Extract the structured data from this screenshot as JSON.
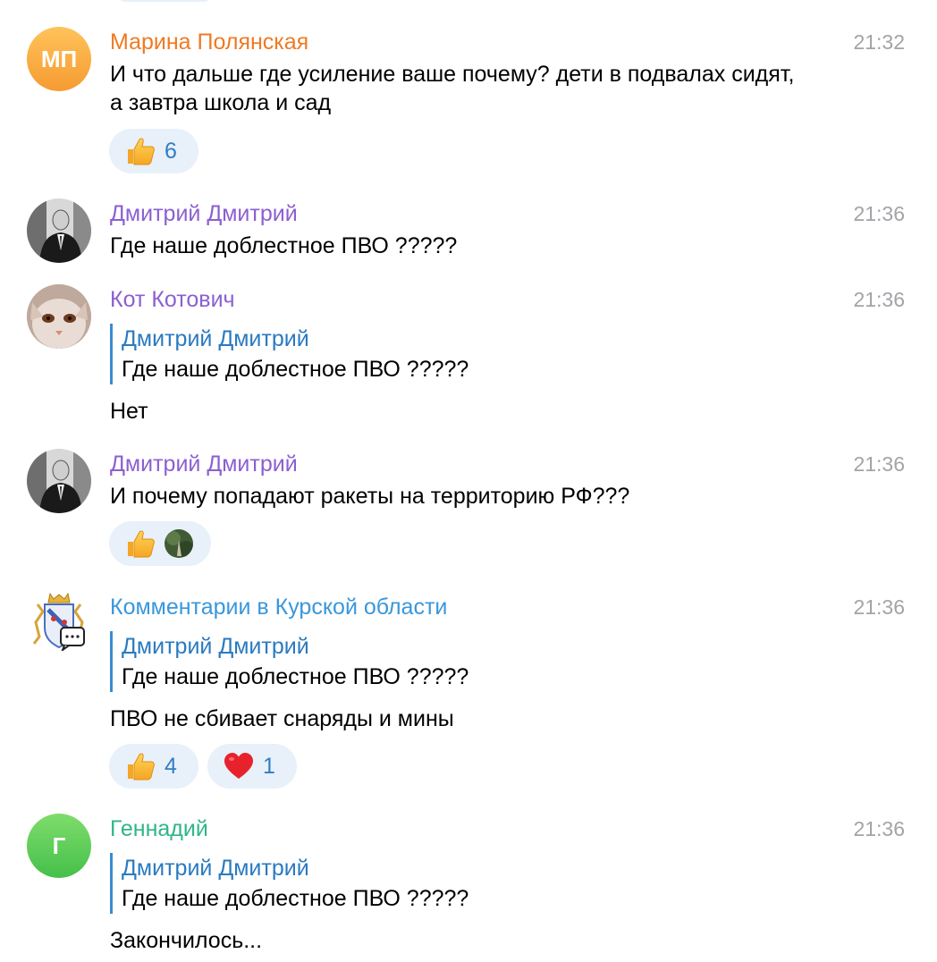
{
  "messages": [
    {
      "author": "Марина Полянская",
      "author_color": "#ef7a24",
      "time": "21:32",
      "avatar_initials": "МП",
      "text": "И что дальше где усиление ваше почему? дети в подвалах сидят, а завтра школа и сад",
      "reactions": [
        {
          "emoji": "thumbs-up-icon",
          "count": "6"
        }
      ]
    },
    {
      "author": "Дмитрий Дмитрий",
      "author_color": "#8c5fd0",
      "time": "21:36",
      "text": "Где наше доблестное ПВО ?????"
    },
    {
      "author": "Кот Котович",
      "author_color": "#8c5fd0",
      "time": "21:36",
      "reply": {
        "author": "Дмитрий Дмитрий",
        "text": "Где наше доблестное ПВО ?????"
      },
      "text": "Нет"
    },
    {
      "author": "Дмитрий Дмитрий",
      "author_color": "#8c5fd0",
      "time": "21:36",
      "text": "И почему попадают ракеты на территорию РФ???",
      "reactions": [
        {
          "emoji": "thumbs-up-icon",
          "count": ""
        }
      ]
    },
    {
      "author": "Комментарии в Курской области",
      "author_color": "#3a97dc",
      "time": "21:36",
      "reply": {
        "author": "Дмитрий Дмитрий",
        "text": "Где наше доблестное ПВО ?????"
      },
      "text": "ПВО не сбивает снаряды и мины",
      "reactions": [
        {
          "emoji": "thumbs-up-icon",
          "count": "4"
        },
        {
          "emoji": "heart-icon",
          "count": "1"
        }
      ]
    },
    {
      "author": "Геннадий",
      "author_color": "#2fb58a",
      "time": "21:36",
      "avatar_initials": "Г",
      "reply": {
        "author": "Дмитрий Дмитрий",
        "text": "Где наше доблестное ПВО ?????"
      },
      "text": "Закончилось..."
    }
  ]
}
